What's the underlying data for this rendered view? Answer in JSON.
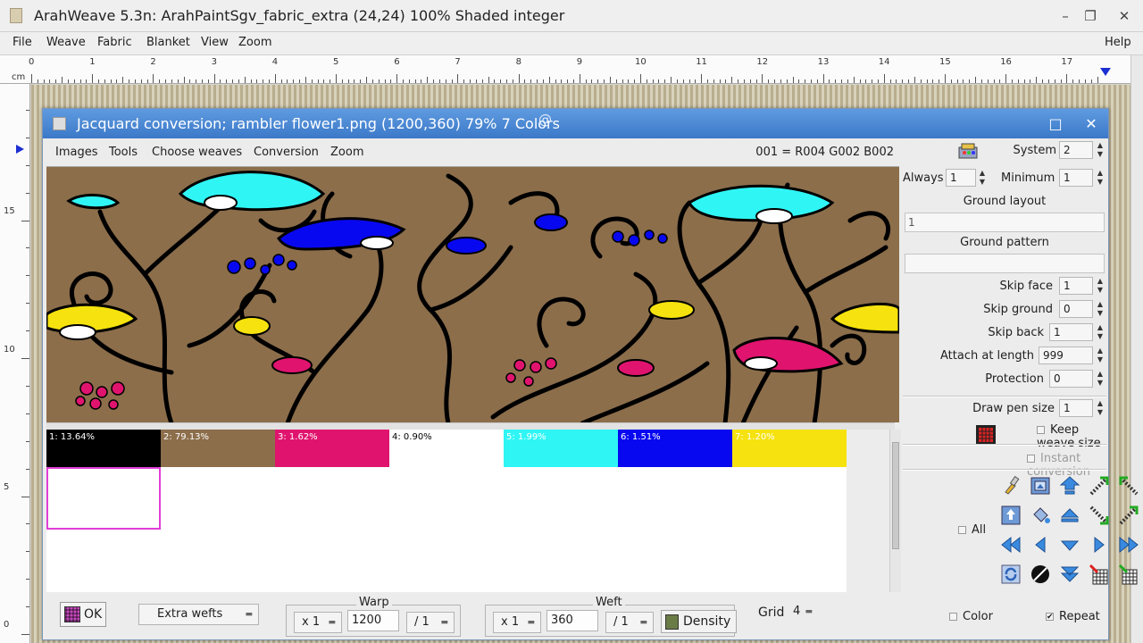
{
  "window": {
    "title": "ArahWeave 5.3n: ArahPaintSgv_fabric_extra (24,24) 100% Shaded integer",
    "minimize": "–",
    "restore": "❐",
    "close": "✕"
  },
  "menubar": {
    "items": [
      "File",
      "Weave",
      "Fabric",
      "Blanket",
      "View",
      "Zoom"
    ],
    "help": "Help"
  },
  "ruler": {
    "unit": "cm",
    "top_numbers": [
      "0",
      "1",
      "2",
      "3",
      "4",
      "5",
      "6",
      "7",
      "8",
      "9",
      "10",
      "11",
      "12",
      "13",
      "14",
      "15",
      "16",
      "17"
    ],
    "left_numbers": [
      "15",
      "10",
      "5",
      "0"
    ]
  },
  "dialog": {
    "title": "Jacquard conversion; rambler flower1.png (1200,360) 79% 7 Colors",
    "maximize": "□",
    "close": "✕",
    "menu": [
      "Images",
      "Tools",
      "Choose weaves",
      "Conversion",
      "Zoom"
    ],
    "status": "001 = R004 G002 B002"
  },
  "colors": [
    {
      "label": "1: 13.64%",
      "color": "#000000",
      "text_color": "#ffffff"
    },
    {
      "label": "2: 79.13%",
      "color": "#8c6e4b",
      "text_color": "#ffffff"
    },
    {
      "label": "3: 1.62%",
      "color": "#e0146e",
      "text_color": "#ffffff"
    },
    {
      "label": "4: 0.90%",
      "color": "#ffffff",
      "text_color": "#000000"
    },
    {
      "label": "5: 1.99%",
      "color": "#30f5f5",
      "text_color": "#ffffff"
    },
    {
      "label": "6: 1.51%",
      "color": "#0808f0",
      "text_color": "#ffffff"
    },
    {
      "label": "7: 1.20%",
      "color": "#f5e20e",
      "text_color": "#ffffff"
    }
  ],
  "bottom": {
    "ok": "OK",
    "extra_wefts": "Extra wefts",
    "warp": {
      "legend": "Warp",
      "mult": "x 1",
      "value": "1200",
      "div": "/ 1"
    },
    "weft": {
      "legend": "Weft",
      "mult": "x 1",
      "value": "360",
      "div": "/ 1"
    },
    "density": "Density",
    "grid_label": "Grid",
    "grid_value": "4"
  },
  "panel": {
    "system_label": "System",
    "system_value": "2",
    "always_label": "Always",
    "always_value": "1",
    "minimum_label": "Minimum",
    "minimum_value": "1",
    "ground_layout_label": "Ground layout",
    "ground_layout_value": "1",
    "ground_pattern_label": "Ground pattern",
    "ground_pattern_value": "",
    "skip_face_label": "Skip face",
    "skip_face_value": "1",
    "skip_ground_label": "Skip ground",
    "skip_ground_value": "0",
    "skip_back_label": "Skip back",
    "skip_back_value": "1",
    "attach_label": "Attach at length",
    "attach_value": "999",
    "protection_label": "Protection",
    "protection_value": "0",
    "draw_pen_label": "Draw pen size",
    "draw_pen_value": "1",
    "keep_weave_size": "Keep weave size",
    "instant_conversion": "Instant conversion",
    "all": "All",
    "color": "Color",
    "repeat": "Repeat",
    "repeat_checked": "✔"
  }
}
